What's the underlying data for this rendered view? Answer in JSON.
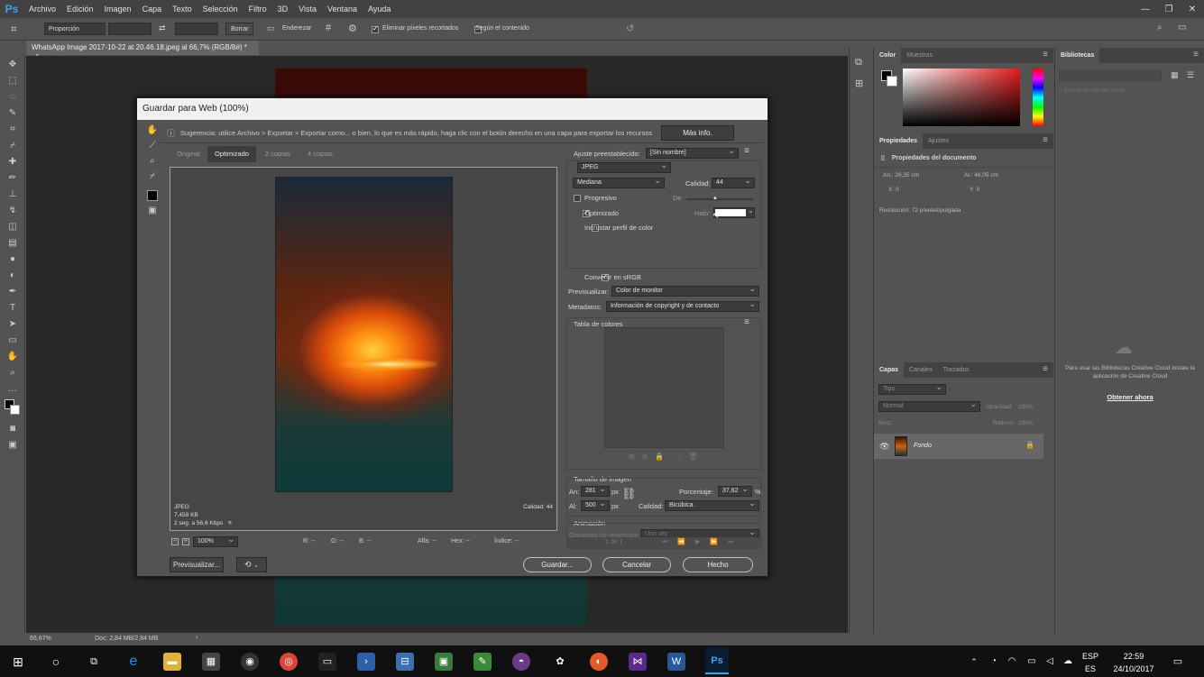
{
  "app": {
    "logo": "Ps",
    "menus": [
      "Archivo",
      "Edición",
      "Imagen",
      "Capa",
      "Texto",
      "Selección",
      "Filtro",
      "3D",
      "Vista",
      "Ventana",
      "Ayuda"
    ]
  },
  "options_bar": {
    "ratio": "Proporción",
    "clear": "Borrar",
    "straighten": "Enderezar",
    "delete_cropped": "Eliminar píxeles recortados",
    "content_aware": "Según el contenido"
  },
  "document_tab": "WhatsApp Image 2017-10-22 at 20.46.18.jpeg al 66,7% (RGB/8#) *",
  "dialog": {
    "title": "Guardar para Web (100%)",
    "hint": "Sugerencia: utilice Archivo > Exportar > Exportar como... o bien, lo que es más rápido, haga clic con el botón derecho en una capa para exportar los recursos",
    "more_info": "Más info.",
    "tabs": [
      "Original",
      "Optimizado",
      "2 copias",
      "4 copias"
    ],
    "preview_meta": {
      "format": "JPEG",
      "size": "7,458 KB",
      "time": "2 seg. a 56,6 Kbps",
      "quality": "Calidad: 44"
    },
    "bottom": {
      "zoom": "100%",
      "r": "R: --",
      "g": "G: --",
      "b": "B: --",
      "alpha": "Alfa: --",
      "hex": "Hex: --",
      "index": "Índice: --"
    },
    "settings": {
      "preset_label": "Ajuste preestablecido:",
      "preset_value": "[Sin nombre]",
      "format": "JPEG",
      "quality_level": "Mediana",
      "quality_label": "Calidad:",
      "quality_value": "44",
      "progressive": "Progresivo",
      "blur_label": "De",
      "optimized": "Optimizado",
      "matte_label": "Halo:",
      "embed_profile": "Incrustar perfil de color",
      "convert_srgb": "Convertir en sRGB",
      "preview_label": "Previsualizar:",
      "preview_value": "Color de monitor",
      "metadata_label": "Metadatos:",
      "metadata_value": "Información de copyright y de contacto",
      "color_table": "Tabla de colores",
      "image_size": "Tamaño de imagen",
      "w_label": "An:",
      "w_value": "281",
      "h_label": "Al:",
      "h_value": "500",
      "px": "px",
      "percent_label": "Porcentaje:",
      "percent_value": "37,62",
      "percent_sign": "%",
      "quality2_label": "Calidad:",
      "quality2_value": "Bicúbica",
      "animation": "Animación",
      "loop_label": "Opciones de repetición:",
      "loop_value": "Una vez",
      "frames": "1 de 1"
    },
    "buttons": {
      "preview": "Previsualizar...",
      "save": "Guardar...",
      "cancel": "Cancelar",
      "done": "Hecho"
    }
  },
  "color_panel": {
    "tabs": [
      "Color",
      "Muestras"
    ]
  },
  "properties_panel": {
    "tabs": [
      "Propiedades",
      "Ajustes"
    ],
    "doc_props": "Propiedades del documento",
    "w": "An.: 26,35 cm",
    "h": "Al.: 46,05 cm",
    "x": "X: 0",
    "y": "Y: 0",
    "resolution": "Resolución: 72 píxeles/pulgada"
  },
  "layers_panel": {
    "tabs": [
      "Capas",
      "Canales",
      "Trazados"
    ],
    "kind": "Tipo",
    "blend": "Normal",
    "opacity_label": "Opacidad:",
    "opacity_value": "100%",
    "lock_label": "Bloq.:",
    "fill_label": "Relleno:",
    "fill_value": "100%",
    "layer_name": "Fondo"
  },
  "libraries_panel": {
    "tab": "Bibliotecas",
    "search_placeholder": "Buscar en Adobe Stock",
    "message": "Para usar las Bibliotecas Creative Cloud instale la aplicación de Creative Cloud",
    "link": "Obtener ahora"
  },
  "status": {
    "zoom": "66,67%",
    "doc": "Doc: 2,84 MB/2,84 MB"
  },
  "taskbar": {
    "lang1": "ESP",
    "lang2": "ES",
    "time": "22:59",
    "date": "24/10/2017"
  },
  "colors": {
    "accent": "#31a8ff",
    "panel": "#535353",
    "menubar": "#424242"
  }
}
